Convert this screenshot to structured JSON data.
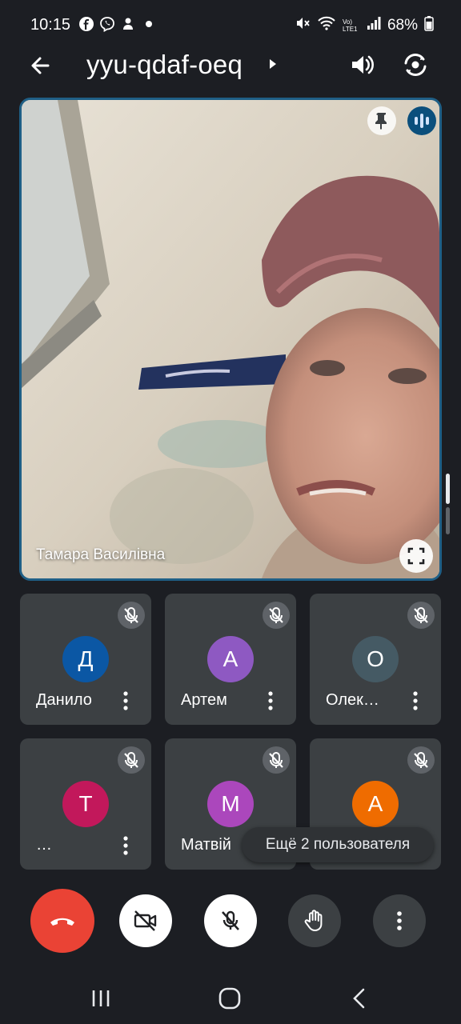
{
  "status_bar": {
    "time": "10:15",
    "app_icons": [
      "facebook-icon",
      "viber-icon",
      "notification-icon"
    ],
    "network": "Vo) LTE1",
    "battery_percent": "68%"
  },
  "header": {
    "meeting_code": "yyu-qdaf-oeq"
  },
  "main_video": {
    "participant_name": "Тамара Василівна",
    "speaking": true
  },
  "participants": [
    {
      "initial": "Д",
      "name": "Данило",
      "color": "#0b57a4",
      "muted": true
    },
    {
      "initial": "А",
      "name": "Артем",
      "color": "#8e59c2",
      "muted": true
    },
    {
      "initial": "О",
      "name": "Олек…",
      "color": "#455a64",
      "muted": true
    },
    {
      "initial": "Т",
      "name": "…",
      "color": "#c2185b",
      "muted": true
    },
    {
      "initial": "М",
      "name": "Матвій",
      "color": "#ab47bc",
      "muted": true
    },
    {
      "initial": "А",
      "name": "",
      "color": "#ef6c00",
      "muted": true
    }
  ],
  "overflow": {
    "label": "Ещё 2 пользователя"
  },
  "controls": {
    "end_call": "end-call-icon",
    "camera": "camera-off-icon",
    "microphone": "mic-off-icon",
    "raise_hand": "hand-icon",
    "more": "more-vert-icon"
  },
  "colors": {
    "background": "#1c1e23",
    "tile": "#3c4043",
    "end_call": "#ea4335",
    "active_border": "#1f5f86"
  }
}
